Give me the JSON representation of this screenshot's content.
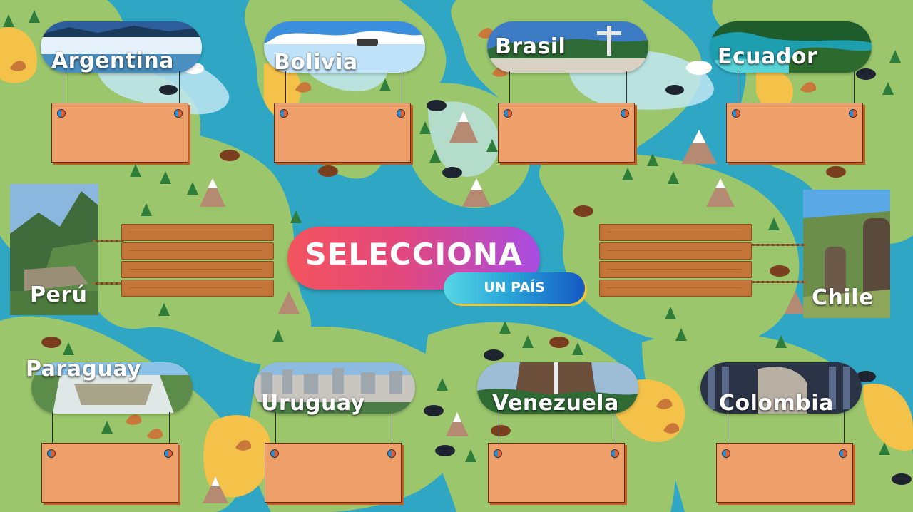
{
  "title": {
    "main": "SELECCIONA",
    "sub": "UN PAÍS"
  },
  "countries": {
    "argentina": "Argentina",
    "bolivia": "Bolivia",
    "brasil": "Brasil",
    "ecuador": "Ecuador",
    "peru": "Perú",
    "chile": "Chile",
    "paraguay": "Paraguay",
    "uruguay": "Uruguay",
    "venezuela": "Venezuela",
    "colombia": "Colombia"
  },
  "colors": {
    "ocean": "#2fa7c4",
    "land": "#9bc66c",
    "sign": "#ef9f69",
    "wood": "#c3753a",
    "title_gradient": [
      "#f3545d",
      "#a84ce2"
    ],
    "subtitle_gradient": [
      "#58d7e6",
      "#1558c4"
    ]
  },
  "icons": [
    "bear-icon",
    "tree-icon",
    "mountain-icon",
    "camel-icon",
    "kangaroo-icon",
    "seal-icon",
    "polar-bear-icon",
    "palm-tree-icon"
  ]
}
